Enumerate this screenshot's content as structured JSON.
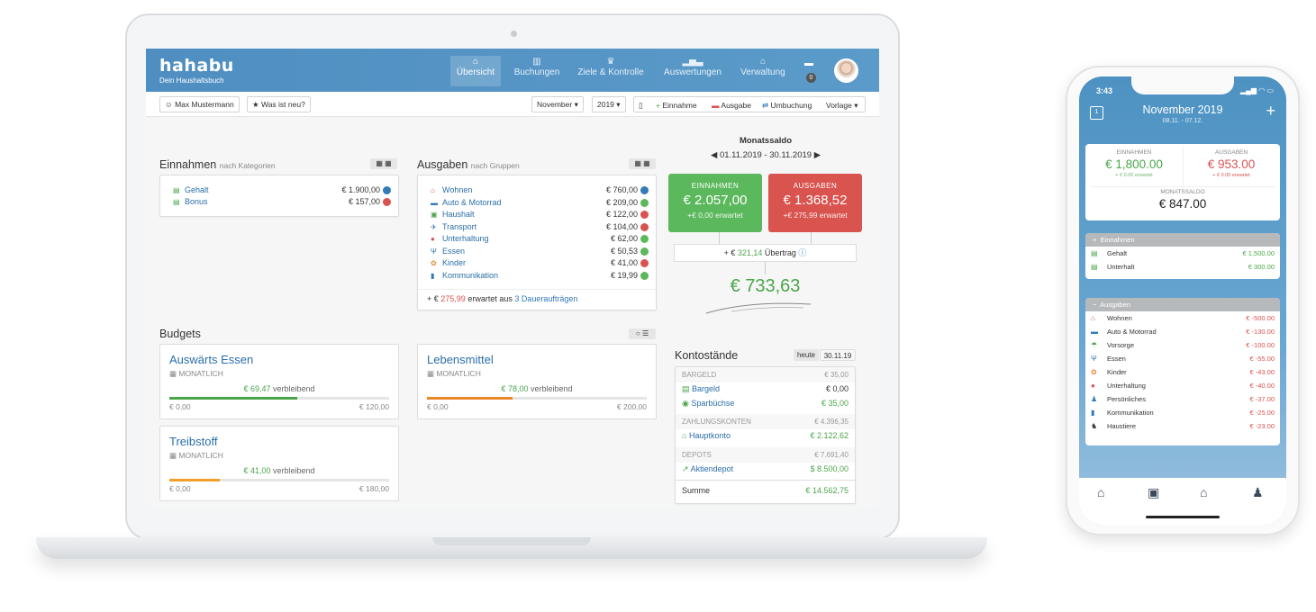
{
  "app": {
    "name": "hahabu",
    "tagline": "Dein Haushaltsbuch"
  },
  "nav": [
    {
      "icon": "home-icon",
      "label": "Übersicht",
      "active": true
    },
    {
      "icon": "book-icon",
      "label": "Buchungen"
    },
    {
      "icon": "trophy-icon",
      "label": "Ziele & Kontrolle"
    },
    {
      "icon": "bar-chart-icon",
      "label": "Auswertungen"
    },
    {
      "icon": "bank-icon",
      "label": "Verwaltung"
    }
  ],
  "notifications": {
    "count": "0"
  },
  "toolbar": {
    "user": "Max Mustermann",
    "whats_new": "Was ist neu?",
    "month": "November",
    "year": "2019",
    "income": "Einnahme",
    "expense": "Ausgabe",
    "transfer": "Umbuchung",
    "template": "Vorlage"
  },
  "income": {
    "title": "Einnahmen",
    "subtitle": "nach Kategorien",
    "items": [
      {
        "name": "Gehalt",
        "value": "€ 1.900,00",
        "status": "blue"
      },
      {
        "name": "Bonus",
        "value": "€ 157,00",
        "status": "red"
      }
    ]
  },
  "expenses": {
    "title": "Ausgaben",
    "subtitle": "nach Gruppen",
    "items": [
      {
        "icon": "house-icon",
        "glyph": "⌂",
        "color": "#d9534f",
        "name": "Wohnen",
        "value": "€ 760,00",
        "status": "blue"
      },
      {
        "icon": "car-icon",
        "glyph": "▬",
        "color": "#337ab7",
        "name": "Auto & Motorrad",
        "value": "€ 209,00",
        "status": "green"
      },
      {
        "icon": "basket-icon",
        "glyph": "▣",
        "color": "#4aa54a",
        "name": "Haushalt",
        "value": "€ 122,00",
        "status": "red"
      },
      {
        "icon": "plane-icon",
        "glyph": "✈",
        "color": "#337ab7",
        "name": "Transport",
        "value": "€ 104,00",
        "status": "red"
      },
      {
        "icon": "pin-icon",
        "glyph": "●",
        "color": "#d9534f",
        "name": "Unterhaltung",
        "value": "€ 62,00",
        "status": "green"
      },
      {
        "icon": "cutlery-icon",
        "glyph": "Ψ",
        "color": "#337ab7",
        "name": "Essen",
        "value": "€ 50,53",
        "status": "green"
      },
      {
        "icon": "kids-icon",
        "glyph": "✿",
        "color": "#e08a2f",
        "name": "Kinder",
        "value": "€ 41,00",
        "status": "red"
      },
      {
        "icon": "phone-icon",
        "glyph": "▮",
        "color": "#337ab7",
        "name": "Kommunikation",
        "value": "€ 19,99",
        "status": "green"
      }
    ],
    "footer_prefix": "+ €",
    "footer_amount": "275,99",
    "footer_mid": "erwartet aus",
    "footer_link": "3 Daueraufträgen"
  },
  "saldo": {
    "title": "Monatssaldo",
    "range": "01.11.2019 - 30.11.2019",
    "income_label": "EINNAHMEN",
    "income_value": "€ 2.057,00",
    "income_expected": "+€ 0,00 erwartet",
    "expense_label": "AUSGABEN",
    "expense_value": "€ 1.368,52",
    "expense_expected": "+€ 275,99 erwartet",
    "carry_prefix": "+ €",
    "carry_value": "321,14",
    "carry_label": "Übertrag",
    "total": "€ 733,63"
  },
  "budgets": {
    "title": "Budgets",
    "items": [
      {
        "name": "Auswärts Essen",
        "period": "MONATLICH",
        "remaining": "€ 69,47",
        "remaining_label": "verbleibend",
        "min": "€ 0,00",
        "max": "€ 120,00",
        "progress": 0.58,
        "color": "#4aa54a"
      },
      {
        "name": "Lebensmittel",
        "period": "MONATLICH",
        "remaining": "€ 78,00",
        "remaining_label": "verbleibend",
        "min": "€ 0,00",
        "max": "€ 200,00",
        "progress": 0.39,
        "color": "#e8862a"
      },
      {
        "name": "Treibstoff",
        "period": "MONATLICH",
        "remaining": "€ 41,00",
        "remaining_label": "verbleibend",
        "min": "€ 0,00",
        "max": "€ 180,00",
        "progress": 0.23,
        "color": "#f0a028"
      }
    ]
  },
  "accounts": {
    "title": "Kontostände",
    "tab_today": "heute",
    "tab_date": "30.11.19",
    "rows": [
      {
        "type": "group",
        "name": "BARGELD",
        "value": "€ 35,00"
      },
      {
        "type": "item",
        "icon": "cash-icon",
        "glyph": "▤",
        "name": "Bargeld",
        "value": "€ 0,00"
      },
      {
        "type": "item",
        "icon": "piggy-icon",
        "glyph": "◉",
        "name": "Sparbüchse",
        "value": "€ 35,00",
        "green": true
      },
      {
        "type": "group",
        "name": "ZAHLUNGSKONTEN",
        "value": "€ 4.396,35"
      },
      {
        "type": "item",
        "icon": "bank-icon",
        "glyph": "⌂",
        "name": "Hauptkonto",
        "value": "€ 2.122,62",
        "green": true
      },
      {
        "type": "group",
        "name": "DEPOTS",
        "value": "€ 7.691,40"
      },
      {
        "type": "item",
        "icon": "stock-icon",
        "glyph": "↗",
        "name": "Aktiendepot",
        "value": "$ 8.500,00",
        "green": true
      },
      {
        "type": "sum",
        "name": "Summe",
        "value": "€ 14.562,75",
        "green": true
      }
    ]
  },
  "phone": {
    "time": "3:43",
    "title": "November 2019",
    "subtitle": "08.11. - 07.12.",
    "cal_day": "1",
    "income_label": "EINNAHMEN",
    "income_value": "€ 1,800.00",
    "income_expected": "+ € 0.00 erwartet",
    "expense_label": "AUSGABEN",
    "expense_value": "€ 953.00",
    "expense_expected": "+ € 0.00 erwartet",
    "saldo_label": "MONATSSALDO",
    "saldo_value": "€ 847.00",
    "income_section": "Einnahmen",
    "income_items": [
      {
        "name": "Gehalt",
        "value": "€ 1,500.00"
      },
      {
        "name": "Unterhalt",
        "value": "€ 300.00"
      }
    ],
    "expense_section": "Ausgaben",
    "expense_items": [
      {
        "icon": "house-icon",
        "glyph": "⌂",
        "color": "#d9534f",
        "name": "Wohnen",
        "value": "€ -500.00"
      },
      {
        "icon": "car-icon",
        "glyph": "▬",
        "color": "#337ab7",
        "name": "Auto & Motorrad",
        "value": "€ -130.00"
      },
      {
        "icon": "umbrella-icon",
        "glyph": "☂",
        "color": "#4aa54a",
        "name": "Vorsorge",
        "value": "€ -100.00"
      },
      {
        "icon": "cutlery-icon",
        "glyph": "Ψ",
        "color": "#337ab7",
        "name": "Essen",
        "value": "€ -55.00"
      },
      {
        "icon": "kids-icon",
        "glyph": "✿",
        "color": "#e08a2f",
        "name": "Kinder",
        "value": "€ -43.00"
      },
      {
        "icon": "pin-icon",
        "glyph": "●",
        "color": "#d9534f",
        "name": "Unterhaltung",
        "value": "€ -40.00"
      },
      {
        "icon": "person-icon",
        "glyph": "♟",
        "color": "#337ab7",
        "name": "Persönliches",
        "value": "€ -37.00"
      },
      {
        "icon": "phone-icon",
        "glyph": "▮",
        "color": "#337ab7",
        "name": "Kommunikation",
        "value": "€ -25.00"
      },
      {
        "icon": "dog-icon",
        "glyph": "♞",
        "color": "#333333",
        "name": "Haustiere",
        "value": "€ -23.00"
      }
    ]
  },
  "colors": {
    "brand": "#5b9bc9",
    "green": "#5cb85c",
    "red": "#d9534f",
    "link": "#2a6ea8"
  }
}
